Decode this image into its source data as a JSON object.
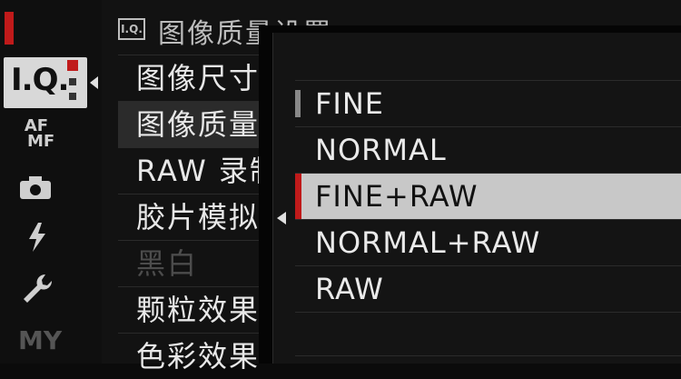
{
  "menu": {
    "icon_label": "I.Q.",
    "title": "图像质量设置",
    "items": [
      {
        "label": "图像尺寸"
      },
      {
        "label": "图像质量"
      },
      {
        "label": "RAW 录制"
      },
      {
        "label": "胶片模拟"
      },
      {
        "label": "黑白"
      },
      {
        "label": "颗粒效果"
      },
      {
        "label": "色彩效果"
      }
    ]
  },
  "rail": {
    "tabs": [
      {
        "label": "I.Q.",
        "icon": "iq-icon",
        "active": true
      },
      {
        "label": "AF MF",
        "icon": "af-mf-icon"
      },
      {
        "label": "",
        "icon": "camera-icon"
      },
      {
        "label": "",
        "icon": "flash-icon"
      },
      {
        "label": "",
        "icon": "wrench-icon"
      },
      {
        "label": "MY",
        "icon": "my-menu-icon"
      }
    ]
  },
  "submenu": {
    "options": [
      {
        "label": "FINE",
        "current": true
      },
      {
        "label": "NORMAL"
      },
      {
        "label": "FINE+RAW",
        "selected": true
      },
      {
        "label": "NORMAL+RAW"
      },
      {
        "label": "RAW"
      }
    ]
  },
  "colors": {
    "accent": "#c01a1a",
    "highlight": "#c8c8c8",
    "background": "#121212"
  }
}
